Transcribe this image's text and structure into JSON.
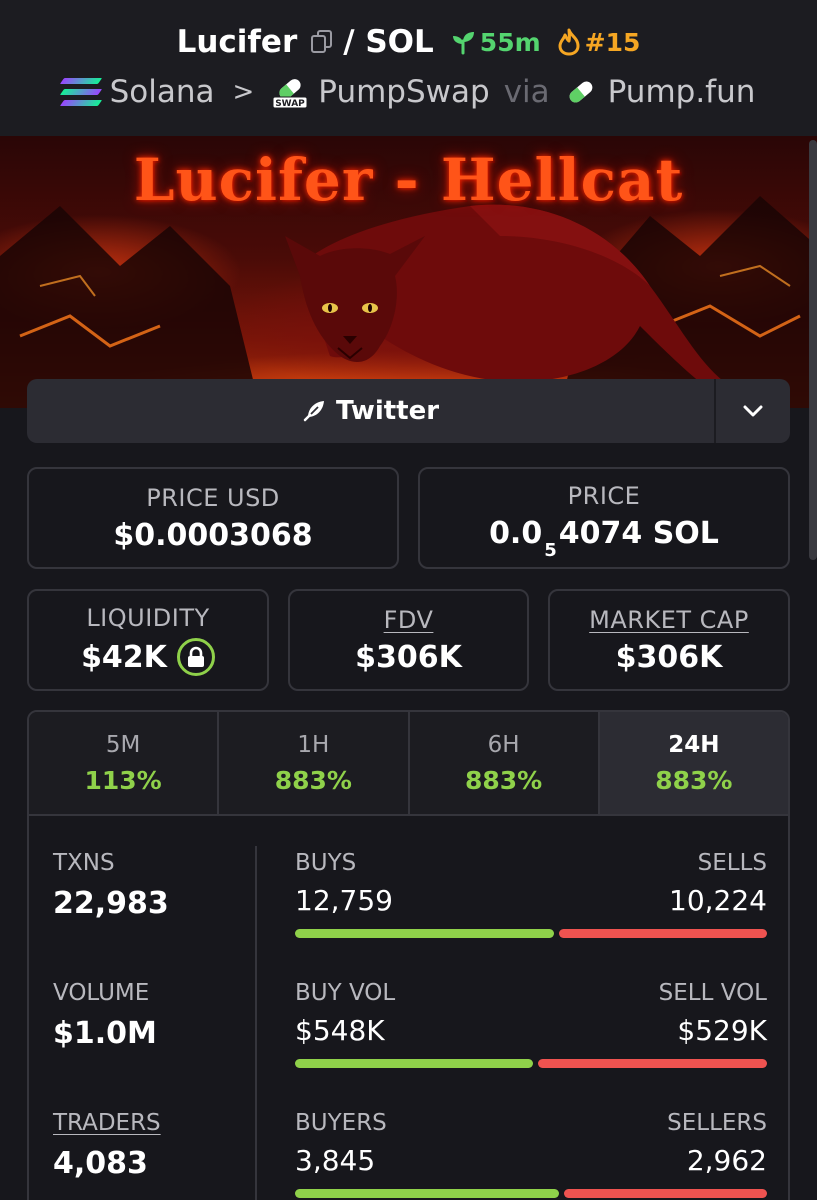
{
  "header": {
    "token_name": "Lucifer",
    "pair_suffix": "/ SOL",
    "age": "55m",
    "rank": "#15",
    "chain": "Solana",
    "separator": ">",
    "dex": "PumpSwap",
    "dex_badge": "SWAP",
    "via": "via",
    "launchpad": "Pump.fun"
  },
  "banner": {
    "title": "Lucifer - Hellcat"
  },
  "social": {
    "twitter_label": "Twitter"
  },
  "prices": {
    "price_usd_label": "PRICE USD",
    "price_usd_value": "$0.0003068",
    "price_label": "PRICE",
    "price_prefix": "0.0",
    "price_zeros": "5",
    "price_digits": "4074 SOL"
  },
  "metrics": {
    "liquidity_label": "LIQUIDITY",
    "liquidity_value": "$42K",
    "fdv_label": "FDV",
    "fdv_value": "$306K",
    "mcap_label": "MARKET CAP",
    "mcap_value": "$306K"
  },
  "timeframes": [
    {
      "label": "5M",
      "value": "113%"
    },
    {
      "label": "1H",
      "value": "883%"
    },
    {
      "label": "6H",
      "value": "883%"
    },
    {
      "label": "24H",
      "value": "883%",
      "active": true
    }
  ],
  "stats": {
    "txns_label": "TXNS",
    "txns_value": "22,983",
    "volume_label": "VOLUME",
    "volume_value": "$1.0M",
    "traders_label": "TRADERS",
    "traders_value": "4,083",
    "buys_label": "BUYS",
    "buys_value": "12,759",
    "sells_label": "SELLS",
    "sells_value": "10,224",
    "buy_vol_label": "BUY VOL",
    "buy_vol_value": "$548K",
    "sell_vol_label": "SELL VOL",
    "sell_vol_value": "$529K",
    "buyers_label": "BUYERS",
    "buyers_value": "3,845",
    "sellers_label": "SELLERS",
    "sellers_value": "2,962",
    "buys_ratio": 0.555,
    "buy_vol_ratio": 0.509,
    "buyers_ratio": 0.565
  },
  "colors": {
    "positive": "#8fd14a",
    "negative": "#ef5350",
    "age": "#54d46f",
    "rank": "#f5a623"
  }
}
